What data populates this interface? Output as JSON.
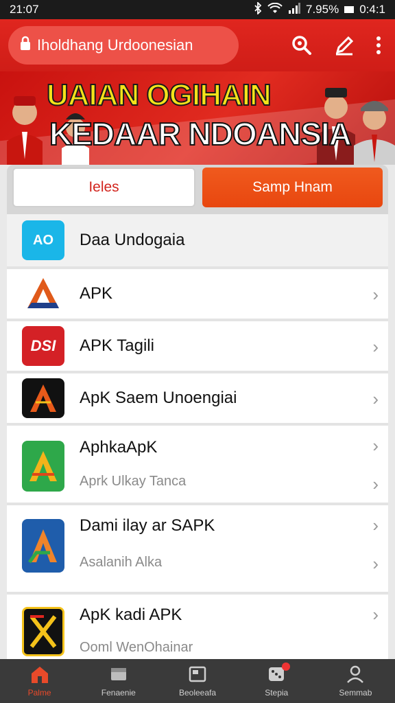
{
  "status_bar": {
    "time": "21:07",
    "battery": "7.95%",
    "clock_right": "0:4:1"
  },
  "app_bar": {
    "title": "Iholdhang Urdoonesian",
    "icons": [
      "lock-icon",
      "search-icon",
      "edit-icon",
      "more-vert-icon"
    ]
  },
  "banner": {
    "line1": "UAIAN OGIHAIN",
    "line2": "KEDAAR NDOANSIA"
  },
  "tabs": [
    {
      "label": "Ieles",
      "active": false
    },
    {
      "label": "Samp Hnam",
      "active": true
    }
  ],
  "list": [
    {
      "title": "Daa Undogaia",
      "subtitle": "",
      "icon_text": "AO",
      "icon_colors": [
        "#1ab6e8",
        "#ffffff"
      ],
      "chevrons": 0
    },
    {
      "title": "APK",
      "subtitle": "",
      "icon_text": "A",
      "icon_colors": [
        "#ffffff",
        "#e05a1a"
      ],
      "chevrons": 1
    },
    {
      "title": "APK Tagili",
      "subtitle": "",
      "icon_text": "DSI",
      "icon_colors": [
        "#d42126",
        "#ffffff"
      ],
      "chevrons": 1
    },
    {
      "title": "ApK Saem Unoengiai",
      "subtitle": "",
      "icon_text": "A",
      "icon_colors": [
        "#111111",
        "#e85a1a"
      ],
      "chevrons": 1
    },
    {
      "title": "AphkaApK",
      "subtitle": "Aprk Ulkay Tanca",
      "icon_text": "A",
      "icon_colors": [
        "#2ea84a",
        "#f4b31a"
      ],
      "chevrons": 2
    },
    {
      "title": "Dami ilay ar SAPK",
      "subtitle": "Asalanih Alka",
      "icon_text": "A",
      "icon_colors": [
        "#1f5dab",
        "#f0842a"
      ],
      "chevrons": 2
    },
    {
      "title": "ApK kadi APK",
      "subtitle": "Ooml WenOhainar",
      "icon_text": "X",
      "icon_colors": [
        "#111111",
        "#f4c21a"
      ],
      "chevrons": 1
    }
  ],
  "bottom_nav": [
    {
      "label": "Palme",
      "icon": "home-icon",
      "active": true
    },
    {
      "label": "Fenaenie",
      "icon": "box-icon",
      "active": false
    },
    {
      "label": "Beoleeafa",
      "icon": "window-icon",
      "active": false
    },
    {
      "label": "Stepia",
      "icon": "dice-icon",
      "active": false,
      "badge": true
    },
    {
      "label": "Semmab",
      "icon": "person-icon",
      "active": false
    }
  ],
  "colors": {
    "accent": "#e0261f",
    "tab_active": "#e8470f",
    "nav_bg": "#3a3a3a"
  }
}
